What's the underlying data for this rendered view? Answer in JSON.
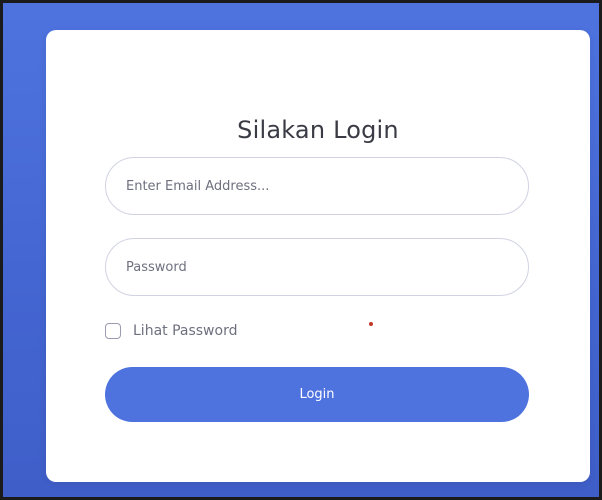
{
  "login_form": {
    "title": "Silakan Login",
    "email_placeholder": "Enter Email Address...",
    "password_placeholder": "Password",
    "show_password_label": "Lihat Password",
    "login_label": "Login"
  },
  "colors": {
    "primary": "#4e73df",
    "background": "#4e73df",
    "card": "#ffffff",
    "text": "#3a3b45",
    "muted_text": "#6e707e",
    "border": "#d1d3e2",
    "dot": "#c0392b"
  }
}
